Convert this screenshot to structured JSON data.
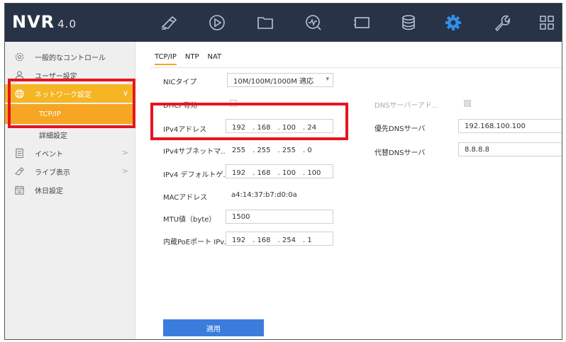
{
  "app": {
    "logo": "NVR",
    "version": "4.0"
  },
  "topbar": {
    "icons": [
      "camera-icon",
      "playback-icon",
      "folder-icon",
      "analytics-icon",
      "screen-icon",
      "storage-icon",
      "settings-gear-icon",
      "maintenance-wrench-icon",
      "grid-icon"
    ],
    "active_color": "#2f8fe8",
    "icon_color": "#b8c3d6"
  },
  "sidebar": {
    "items": [
      {
        "label": "一般的なコントロール"
      },
      {
        "label": "ユーザー設定"
      },
      {
        "label": "ネットワーク設定"
      },
      {
        "label": "TCP/IP"
      },
      {
        "label": "詳細設定"
      },
      {
        "label": "イベント"
      },
      {
        "label": "ライブ表示"
      },
      {
        "label": "休日設定"
      }
    ],
    "chevron": ">",
    "chevron_down": "∨"
  },
  "tabs": [
    "TCP/IP",
    "NTP",
    "NAT"
  ],
  "form": {
    "nic_label": "NICタイプ",
    "nic_value": "10M/100M/1000M 適応",
    "dhcp_label": "DHCP有効",
    "ipv4_label": "IPv4アドレス",
    "ipv4_value": "192　. 168　. 100　. 24",
    "subnet_label": "IPv4サブネットマ...",
    "subnet_value": "255　. 255　. 255　. 0",
    "gateway_label": "IPv4 デフォルトゲ...",
    "gateway_value": "192　. 168　. 100　. 100",
    "mac_label": "MACアドレス",
    "mac_value": "a4:14:37:b7:d0:0a",
    "mtu_label": "MTU値（byte）",
    "mtu_value": "1500",
    "poe_label": "内蔵PoEポート IPv...",
    "poe_value": "192　. 168　. 254　. 1",
    "dns_auto_label": "DNSサーバーアド...",
    "dns_primary_label": "優先DNSサーバ",
    "dns_primary_value": "192.168.100.100",
    "dns_secondary_label": "代替DNSサーバ",
    "dns_secondary_value": "8.8.8.8",
    "apply_label": "適用"
  },
  "colors": {
    "accent_orange": "#f6a623",
    "highlight_red": "#e8141e",
    "button_blue": "#3b7ddd",
    "topbar_bg": "#293347"
  }
}
